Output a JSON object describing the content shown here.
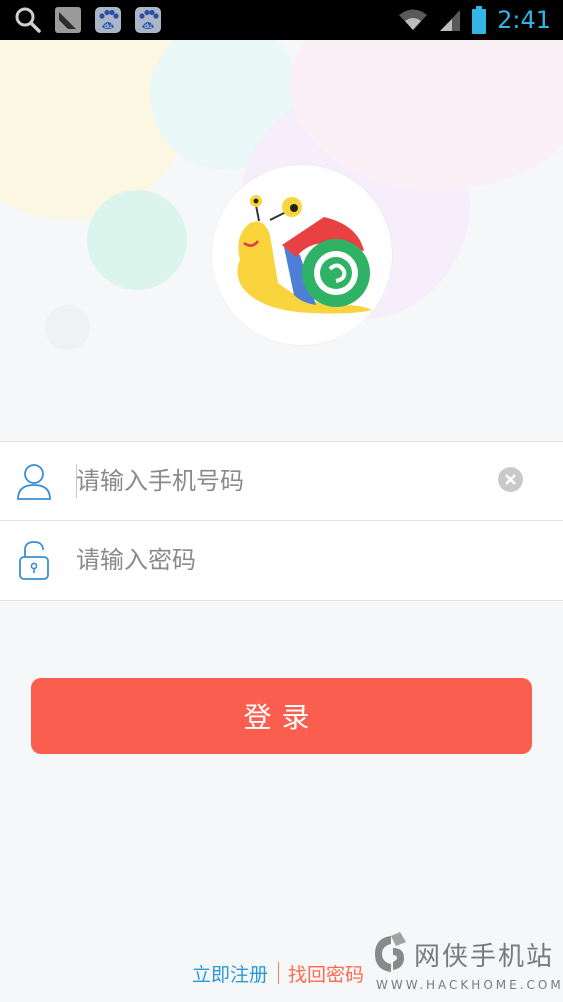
{
  "status_bar": {
    "time": "2:41",
    "left_icons": [
      "search-icon",
      "silent-mode-icon",
      "baidu-app-icon",
      "baidu-app-icon"
    ],
    "right_icons": [
      "wifi-icon",
      "signal-icon",
      "battery-icon"
    ],
    "accent_color": "#33b5e5"
  },
  "logo": {
    "icon": "snail-logo-icon"
  },
  "form": {
    "phone": {
      "icon": "user-icon",
      "placeholder": "请输入手机号码",
      "value": "",
      "clear_icon": "clear-icon"
    },
    "password": {
      "icon": "unlock-icon",
      "placeholder": "请输入密码",
      "value": ""
    }
  },
  "login": {
    "label": "登录",
    "color": "#fa5e4f"
  },
  "footer": {
    "register_label": "立即注册",
    "forgot_label": "找回密码",
    "register_color": "#2a9ad6",
    "forgot_color": "#ff6a4d"
  },
  "watermark": {
    "title": "网侠手机站",
    "subtitle": "WWW.HACKHOME.COM"
  }
}
